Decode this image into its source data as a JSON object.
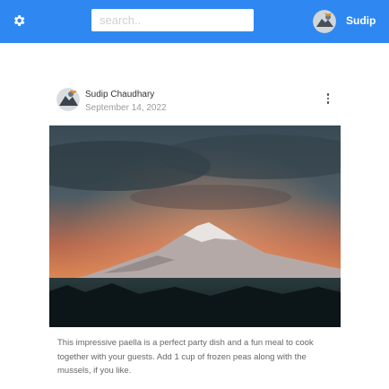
{
  "header": {
    "search_placeholder": "search..",
    "user_name": "Sudip",
    "brand_color": "#2f88f1",
    "settings_icon": "gear-icon",
    "avatar_icon": "avatar"
  },
  "post": {
    "author": "Sudip Chaudhary",
    "date": "September 14, 2022",
    "more_icon": "more-vertical-icon",
    "image": "mountain-at-sunset",
    "text": "This impressive paella is a perfect party dish and a fun meal to cook together with your guests. Add 1 cup of frozen peas along with the mussels, if you like."
  }
}
